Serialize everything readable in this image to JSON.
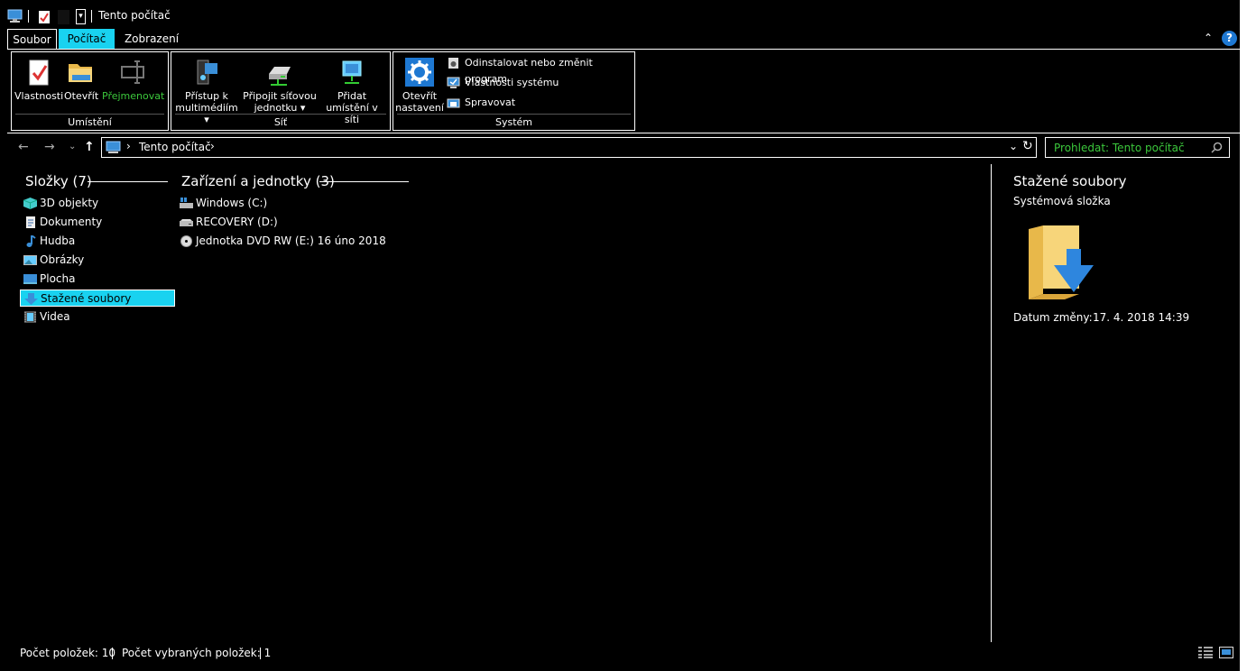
{
  "window": {
    "title": "Tento počítač"
  },
  "tabs": [
    {
      "label": "Soubor"
    },
    {
      "label": "Počítač"
    },
    {
      "label": "Zobrazení"
    }
  ],
  "ribbon": {
    "groups": {
      "location": {
        "label": "Umístění",
        "properties": "Vlastnosti",
        "open": "Otevřít",
        "rename": "Přejmenovat"
      },
      "network": {
        "label": "Síť",
        "media_l1": "Přístup k",
        "media_l2": "multimédiím",
        "map_l1": "Připojit síťovou",
        "map_l2": "jednotku",
        "add_l1": "Přidat",
        "add_l2": "umístění v síti"
      },
      "system": {
        "label": "Systém",
        "settings_l1": "Otevřít",
        "settings_l2": "nastavení",
        "uninstall": "Odinstalovat nebo změnit program",
        "sysprops": "Vlastnosti systému",
        "manage": "Spravovat"
      }
    }
  },
  "address": {
    "path": "Tento počítač"
  },
  "search": {
    "placeholder": "Prohledat: Tento počítač"
  },
  "folders": {
    "heading": "Složky (7)",
    "items": [
      {
        "label": "3D objekty",
        "icon": "3d-objects-icon"
      },
      {
        "label": "Dokumenty",
        "icon": "documents-icon"
      },
      {
        "label": "Hudba",
        "icon": "music-icon"
      },
      {
        "label": "Obrázky",
        "icon": "pictures-icon"
      },
      {
        "label": "Plocha",
        "icon": "desktop-icon"
      },
      {
        "label": "Stažené soubory",
        "icon": "downloads-icon",
        "selected": true
      },
      {
        "label": "Videa",
        "icon": "videos-icon"
      }
    ]
  },
  "drives": {
    "heading": "Zařízení a jednotky (3)",
    "items": [
      {
        "label": "Windows (C:)",
        "icon": "windows-drive-icon"
      },
      {
        "label": "RECOVERY (D:)",
        "icon": "drive-icon"
      },
      {
        "label": "Jednotka DVD RW (E:) 16 úno 2018",
        "icon": "dvd-icon"
      }
    ]
  },
  "details": {
    "name": "Stažené soubory",
    "type": "Systémová složka",
    "date_label": "Datum změny:",
    "date_value": "17. 4. 2018 14:39"
  },
  "status": {
    "count": "Počet položek: 10",
    "selected": "Počet vybraných položek: 1"
  },
  "colors": {
    "accent": "#19d2f0",
    "link": "#3cc83c",
    "background": "#000000"
  }
}
